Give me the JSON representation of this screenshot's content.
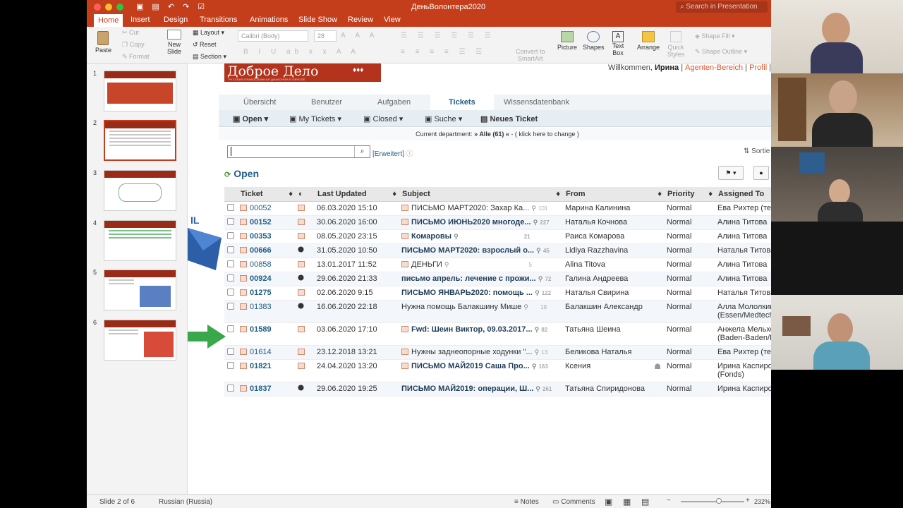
{
  "window": {
    "title": "ДеньВолонтера2020",
    "search_placeholder": "Search in Presentation"
  },
  "ribbon_tabs": [
    "Home",
    "Insert",
    "Design",
    "Transitions",
    "Animations",
    "Slide Show",
    "Review",
    "View"
  ],
  "ribbon": {
    "paste": "Paste",
    "cut": "Cut",
    "copy": "Copy",
    "format": "Format",
    "new_slide_1": "New",
    "new_slide_2": "Slide",
    "layout": "Layout",
    "reset": "Reset",
    "section": "Section",
    "font_name": "Calibri (Body)",
    "font_size": "28",
    "convert_1": "Convert to",
    "convert_2": "SmartArt",
    "picture": "Picture",
    "shapes": "Shapes",
    "textbox_1": "Text",
    "textbox_2": "Box",
    "arrange": "Arrange",
    "quick_styles_1": "Quick",
    "quick_styles_2": "Styles",
    "shape_fill": "Shape Fill",
    "shape_outline": "Shape Outline"
  },
  "slides": [
    "1",
    "2",
    "3",
    "4",
    "5",
    "6"
  ],
  "slide_text": {
    "logo_title": "Доброе Дело",
    "logo_sub": "РУССКАЯ ПРАВОСЛАВНАЯ ДИАКОНИЯ В ЕВРОПЕ",
    "welcome_prefix": "Willkommen, ",
    "welcome_user": "Ирина",
    "agent_area": "Agenten-Bereich",
    "profile": "Profil"
  },
  "nav_tabs": {
    "overview": "Übersicht",
    "users": "Benutzer",
    "tasks": "Aufgaben",
    "tickets": "Tickets",
    "kb": "Wissensdatenbank"
  },
  "subnav": {
    "open": "Open",
    "my_tickets": "My Tickets",
    "closed": "Closed",
    "search": "Suche",
    "new_ticket": "Neues Ticket"
  },
  "department": {
    "prefix": "Current department: ",
    "value": "» Alle (61) «",
    "suffix": " - ( klick here to change )"
  },
  "search": {
    "advanced": "[Erweitert]",
    "sort": "Sortie"
  },
  "section_title": "Open",
  "columns": [
    "Ticket",
    "Last Updated",
    "Subject",
    "From",
    "Priority",
    "Assigned To"
  ],
  "rows": [
    {
      "id": "00052",
      "updated": "06.03.2020 15:10",
      "subject": "ПИСЬМО МАРТ2020: Захар Ка...",
      "count": "101",
      "from": "Марина Калинина",
      "priority": "Normal",
      "assigned": "Ева Рихтер (те"
    },
    {
      "id": "00152",
      "updated": "30.06.2020 16:00",
      "subject": "ПИСЬМО ИЮНЬ2020 многоде...",
      "count": "227",
      "from": "Наталья Кочнова",
      "priority": "Normal",
      "assigned": "Алина Титова"
    },
    {
      "id": "00353",
      "updated": "08.05.2020 23:15",
      "subject": "Комаровы",
      "count": "21",
      "from": "Раиса Комарова",
      "priority": "Normal",
      "assigned": "Алина Титова"
    },
    {
      "id": "00666",
      "updated": "31.05.2020 10:50",
      "subject": "ПИСЬМО МАРТ2020: взрослый о...",
      "count": "45",
      "from": "Lidiya Razzhavina",
      "priority": "Normal",
      "assigned": "Наталья Титова"
    },
    {
      "id": "00858",
      "updated": "13.01.2017 11:52",
      "subject": "ДЕНЬГИ",
      "count": "5",
      "from": "Alina Titova",
      "priority": "Normal",
      "assigned": "Алина Титова"
    },
    {
      "id": "00924",
      "updated": "29.06.2020 21:33",
      "subject": "письмо апрель: лечение с прожи...",
      "count": "72",
      "from": "Галина Андреева",
      "priority": "Normal",
      "assigned": "Алина Титова"
    },
    {
      "id": "01275",
      "updated": "02.06.2020 9:15",
      "subject": "ПИСЬМО ЯНВАРЬ2020: помощь ...",
      "count": "122",
      "from": "Наталья Свирина",
      "priority": "Normal",
      "assigned": "Наталья Титова"
    },
    {
      "id": "01383",
      "updated": "16.06.2020 22:18",
      "subject": "Нужна помощь Балакшину Мише",
      "count": "19",
      "from": "Балакшин Александр",
      "priority": "Normal",
      "assigned": "Алла Мололкин",
      "assigned2": "(Essen/Medtech"
    },
    {
      "id": "01589",
      "updated": "03.06.2020 17:10",
      "subject": "Fwd: Шеин Виктор, 09.03.2017...",
      "count": "82",
      "from": "Татьяна Шеина",
      "priority": "Normal",
      "assigned": "Анжела Мельхо",
      "assigned2": "(Baden-Baden/K"
    },
    {
      "id": "01614",
      "updated": "23.12.2018 13:21",
      "subject": "Нужны заднеопорные ходунки \"...",
      "count": "13",
      "from": "Беликова Наталья",
      "priority": "Normal",
      "assigned": "Ева Рихтер (те"
    },
    {
      "id": "01821",
      "updated": "24.04.2020 13:20",
      "subject": "ПИСЬМО МАЙ2019 Саша Про...",
      "count": "163",
      "from": "Ксения",
      "priority": "Normal",
      "assigned": "Ирина Каспиро",
      "assigned2": "(Fonds)"
    },
    {
      "id": "01837",
      "updated": "29.06.2020 19:25",
      "subject": "ПИСЬМО МАЙ2019: операции, Ш...",
      "count": "261",
      "from": "Татьяна Спиридонова",
      "priority": "Normal",
      "assigned": "Ирина Каспирович"
    }
  ],
  "status": {
    "slide": "Slide 2 of 6",
    "language": "Russian (Russia)",
    "notes": "Notes",
    "comments": "Comments",
    "zoom": "232%"
  }
}
